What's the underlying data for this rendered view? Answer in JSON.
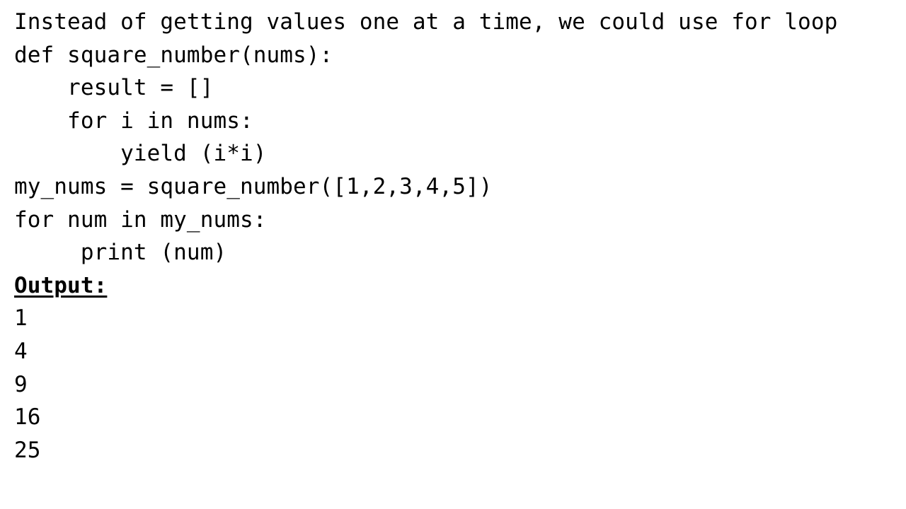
{
  "slide": {
    "intro": "Instead of getting values one at a time, we could use for loop",
    "code": [
      "def square_number(nums):",
      "    result = []",
      "    for i in nums:",
      "        yield (i*i)",
      "my_nums = square_number([1,2,3,4,5])",
      "for num in my_nums:",
      "     print (num)"
    ],
    "output_heading": "Output:",
    "output": [
      "1",
      "4",
      "9",
      "16",
      "25"
    ]
  }
}
